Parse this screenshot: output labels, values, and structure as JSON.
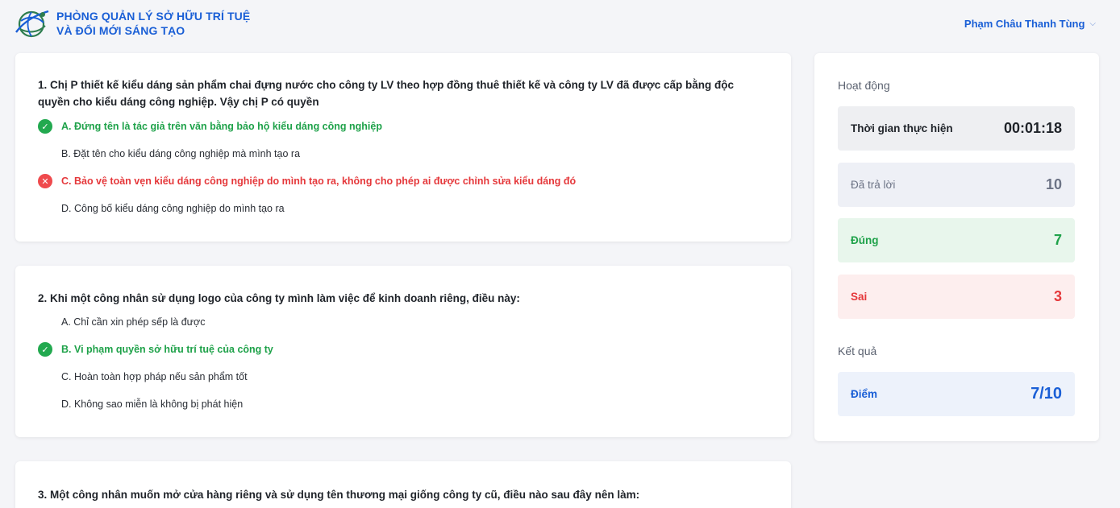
{
  "header": {
    "brand_line1": "PHÒNG QUẢN LÝ SỞ HỮU TRÍ TUỆ",
    "brand_line2": "VÀ ĐỔI MỚI SÁNG TẠO",
    "user_name": "Phạm Châu Thanh Tùng",
    "brand_color": "#1a5fd6"
  },
  "questions": [
    {
      "text": "1. Chị P thiết kế kiểu dáng sản phẩm chai đựng nước cho công ty LV theo hợp đồng thuê thiết kế và công ty LV đã được cấp bằng độc quyền cho kiểu dáng công nghiệp. Vậy chị P có quyền",
      "options": [
        {
          "label": "A. Đứng tên là tác giả trên văn bằng bảo hộ kiểu dáng công nghiệp",
          "state": "correct"
        },
        {
          "label": "B. Đặt tên cho kiểu dáng công nghiệp mà mình tạo ra",
          "state": "none"
        },
        {
          "label": "C. Bảo vệ toàn vẹn kiểu dáng công nghiệp do mình tạo ra, không cho phép ai được chỉnh sửa kiểu dáng đó",
          "state": "wrong"
        },
        {
          "label": "D. Công bố kiểu dáng công nghiệp do mình tạo ra",
          "state": "none"
        }
      ]
    },
    {
      "text": "2. Khi một công nhân sử dụng logo của công ty mình làm việc để kinh doanh riêng, điều này:",
      "options": [
        {
          "label": "A. Chỉ cần xin phép sếp là được",
          "state": "none"
        },
        {
          "label": "B. Vi phạm quyền sở hữu trí tuệ của công ty",
          "state": "correct"
        },
        {
          "label": "C. Hoàn toàn hợp pháp nếu sản phẩm tốt",
          "state": "none"
        },
        {
          "label": "D. Không sao miễn là không bị phát hiện",
          "state": "none"
        }
      ]
    },
    {
      "text": "3. Một công nhân muốn mở cửa hàng riêng và sử dụng tên thương mại giống công ty cũ, điều nào sau đây nên làm:"
    }
  ],
  "panel": {
    "activity_title": "Hoạt động",
    "time_label": "Thời gian thực hiện",
    "time_value": "00:01:18",
    "answered_label": "Đã trả lời",
    "answered_value": "10",
    "correct_label": "Đúng",
    "correct_value": "7",
    "wrong_label": "Sai",
    "wrong_value": "3",
    "result_title": "Kết quả",
    "score_label": "Điểm",
    "score_value": "7/10"
  },
  "colors": {
    "correct": "#1fa24a",
    "wrong": "#e5383b",
    "accent": "#1a5fd6"
  }
}
